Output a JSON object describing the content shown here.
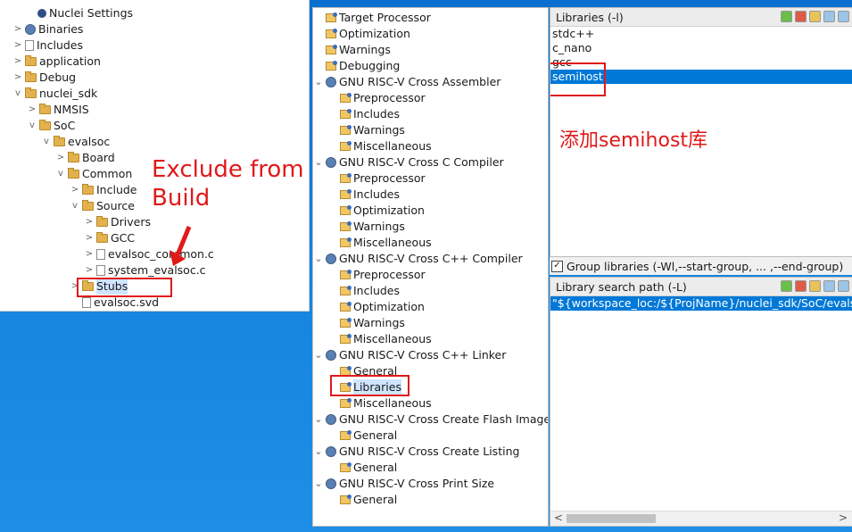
{
  "project_tree": [
    {
      "label": "Nuclei Settings",
      "icon": "nuclei-icon",
      "arrow": ""
    },
    {
      "label": "Binaries",
      "icon": "gear-icon",
      "arrow": ">"
    },
    {
      "label": "Includes",
      "icon": "includes-icon",
      "arrow": ">"
    },
    {
      "label": "application",
      "icon": "folder-icon",
      "arrow": ">"
    },
    {
      "label": "Debug",
      "icon": "folder-icon",
      "arrow": ">"
    },
    {
      "label": "nuclei_sdk",
      "icon": "folder-icon",
      "arrow": "v"
    },
    {
      "label": "NMSIS",
      "icon": "folder-icon",
      "arrow": ">"
    },
    {
      "label": "SoC",
      "icon": "folder-icon",
      "arrow": "v"
    },
    {
      "label": "evalsoc",
      "icon": "folder-icon",
      "arrow": "v"
    },
    {
      "label": "Board",
      "icon": "folder-icon",
      "arrow": ">"
    },
    {
      "label": "Common",
      "icon": "folder-icon",
      "arrow": "v"
    },
    {
      "label": "Include",
      "icon": "folder-icon",
      "arrow": ">"
    },
    {
      "label": "Source",
      "icon": "folder-icon",
      "arrow": "v"
    },
    {
      "label": "Drivers",
      "icon": "folder-icon",
      "arrow": ">"
    },
    {
      "label": "GCC",
      "icon": "folder-icon",
      "arrow": ">"
    },
    {
      "label": "evalsoc_common.c",
      "icon": "c-file-icon",
      "arrow": ">"
    },
    {
      "label": "system_evalsoc.c",
      "icon": "c-file-icon",
      "arrow": ">"
    },
    {
      "label": "Stubs",
      "icon": "excluded-folder-icon",
      "arrow": ">"
    },
    {
      "label": "evalsoc.svd",
      "icon": "file-icon",
      "arrow": ""
    }
  ],
  "annotation_left": {
    "line1": "Exclude from",
    "line2": "Build"
  },
  "settings_tree": [
    {
      "label": "Target Processor",
      "level": 0
    },
    {
      "label": "Optimization",
      "level": 0
    },
    {
      "label": "Warnings",
      "level": 0
    },
    {
      "label": "Debugging",
      "level": 0
    },
    {
      "label": "GNU RISC-V Cross Assembler",
      "level": -1
    },
    {
      "label": "Preprocessor",
      "level": 1
    },
    {
      "label": "Includes",
      "level": 1
    },
    {
      "label": "Warnings",
      "level": 1
    },
    {
      "label": "Miscellaneous",
      "level": 1
    },
    {
      "label": "GNU RISC-V Cross C Compiler",
      "level": -1
    },
    {
      "label": "Preprocessor",
      "level": 1
    },
    {
      "label": "Includes",
      "level": 1
    },
    {
      "label": "Optimization",
      "level": 1
    },
    {
      "label": "Warnings",
      "level": 1
    },
    {
      "label": "Miscellaneous",
      "level": 1
    },
    {
      "label": "GNU RISC-V Cross C++ Compiler",
      "level": -1
    },
    {
      "label": "Preprocessor",
      "level": 1
    },
    {
      "label": "Includes",
      "level": 1
    },
    {
      "label": "Optimization",
      "level": 1
    },
    {
      "label": "Warnings",
      "level": 1
    },
    {
      "label": "Miscellaneous",
      "level": 1
    },
    {
      "label": "GNU RISC-V Cross C++ Linker",
      "level": -1
    },
    {
      "label": "General",
      "level": 1
    },
    {
      "label": "Libraries",
      "level": 1
    },
    {
      "label": "Miscellaneous",
      "level": 1
    },
    {
      "label": "GNU RISC-V Cross Create Flash Image",
      "level": -1
    },
    {
      "label": "General",
      "level": 1
    },
    {
      "label": "GNU RISC-V Cross Create Listing",
      "level": -1
    },
    {
      "label": "General",
      "level": 1
    },
    {
      "label": "GNU RISC-V Cross Print Size",
      "level": -1
    },
    {
      "label": "General",
      "level": 1
    }
  ],
  "libraries": {
    "header": "Libraries (-l)",
    "items": [
      "stdc++",
      "c_nano",
      "gcc",
      "semihost"
    ],
    "annotation": "添加semihost库"
  },
  "group_libraries": {
    "label": "Group libraries (-Wl,--start-group, ... ,--end-group)",
    "checked": "✓"
  },
  "library_search": {
    "header": "Library search path (-L)",
    "items": [
      "\"${workspace_loc:/${ProjName}/nuclei_sdk/SoC/evalsoc/Bo"
    ]
  },
  "scroll": {
    "left": "<",
    "right": ">"
  }
}
